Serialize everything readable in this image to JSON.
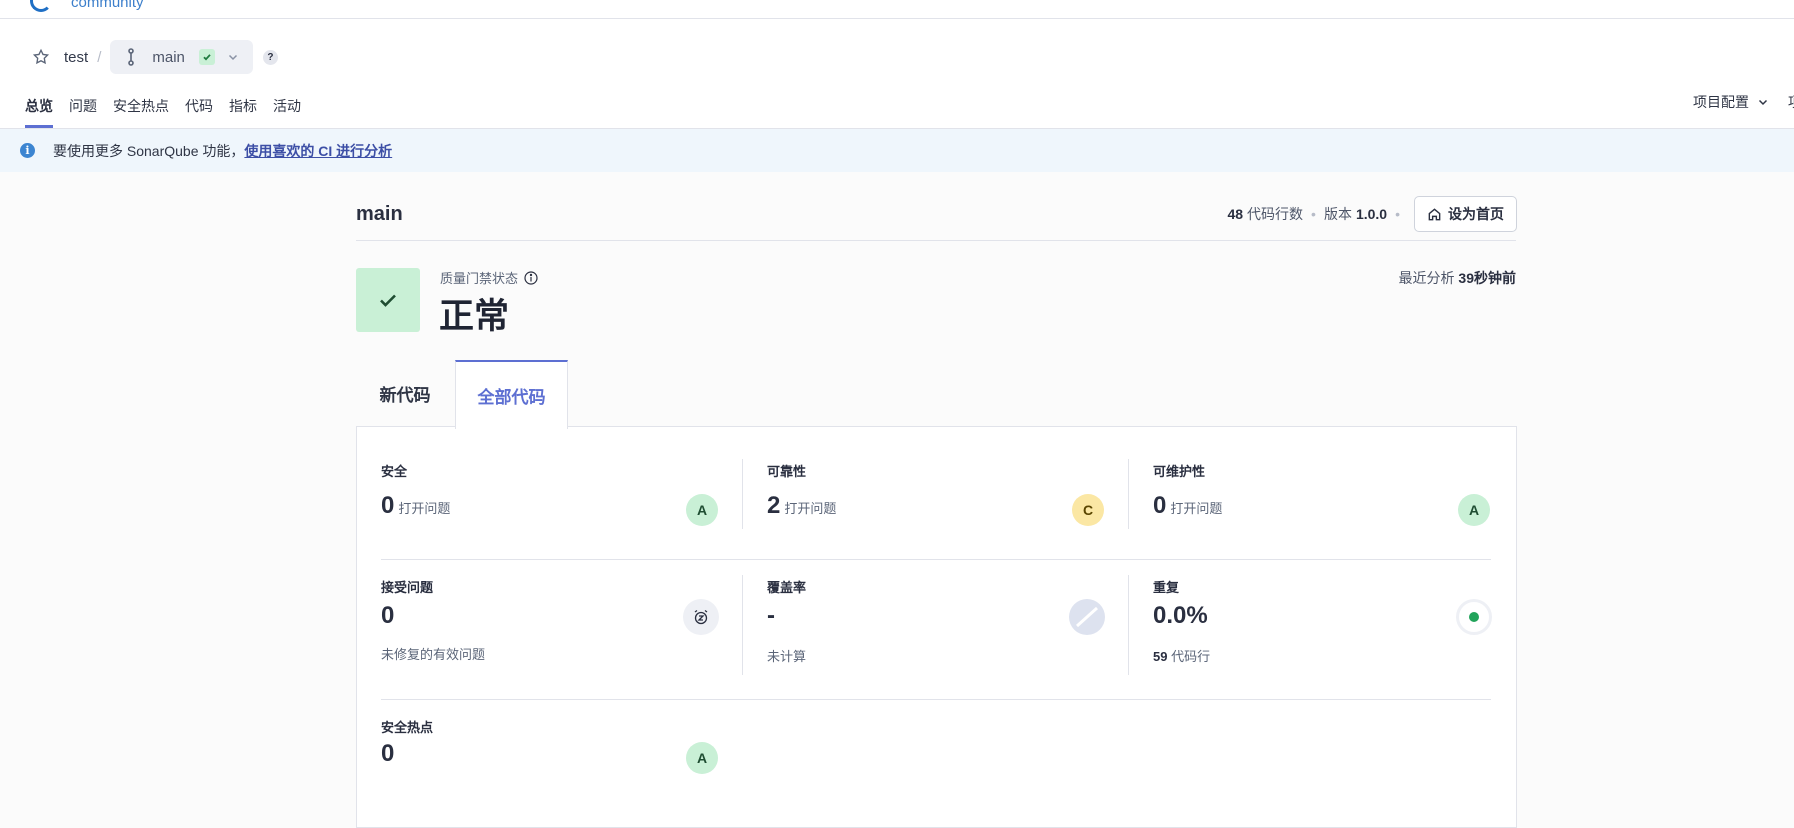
{
  "brand": {
    "name": "community"
  },
  "breadcrumb": {
    "project": "test",
    "separator": "/",
    "branch": "main",
    "help": "?"
  },
  "tabs": [
    "总览",
    "问题",
    "安全热点",
    "代码",
    "指标",
    "活动"
  ],
  "header_right": {
    "project_config": "项目配置",
    "partial": "项"
  },
  "banner": {
    "text": "要使用更多 SonarQube 功能，",
    "link": "使用喜欢的 CI 进行分析"
  },
  "branch_header": {
    "name": "main",
    "loc_value": "48",
    "loc_label": "代码行数",
    "version_label": "版本",
    "version_value": "1.0.0",
    "set_home": "设为首页"
  },
  "quality_gate": {
    "label": "质量门禁状态",
    "status": "正常",
    "last_analysis_label": "最近分析",
    "last_analysis_value": "39秒钟前"
  },
  "code_tabs": {
    "new": "新代码",
    "all": "全部代码"
  },
  "metrics": {
    "security": {
      "title": "安全",
      "value": "0",
      "sub": "打开问题",
      "rating": "A"
    },
    "reliability": {
      "title": "可靠性",
      "value": "2",
      "sub": "打开问题",
      "rating": "C"
    },
    "maintainability": {
      "title": "可维护性",
      "value": "0",
      "sub": "打开问题",
      "rating": "A"
    },
    "accepted": {
      "title": "接受问题",
      "value": "0",
      "foot": "未修复的有效问题"
    },
    "coverage": {
      "title": "覆盖率",
      "value": "-",
      "foot": "未计算"
    },
    "duplication": {
      "title": "重复",
      "value": "0.0%",
      "foot_value": "59",
      "foot_label": "代码行"
    },
    "hotspots": {
      "title": "安全热点",
      "value": "0",
      "rating": "A"
    }
  },
  "colors": {
    "accent": "#5d6fd2",
    "rating_a_bg": "#c9f0d6",
    "rating_c_bg": "#fbe7a4",
    "pass_bg": "#c9f0d6"
  }
}
